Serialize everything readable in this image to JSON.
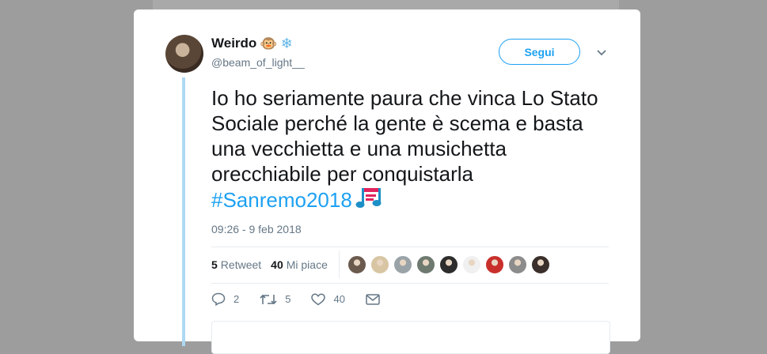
{
  "tweet": {
    "display_name": "Weirdo",
    "name_emojis": [
      "🐵",
      "❄"
    ],
    "handle": "@beam_of_light__",
    "follow_label": "Segui",
    "text": "Io ho seriamente paura che vinca Lo Stato Sociale perché la gente è scema e basta una vecchietta e una musichetta orecchiabile per conquistarla",
    "hashtag": "#Sanremo2018",
    "timestamp": "09:26 - 9 feb 2018"
  },
  "stats": {
    "retweets_count": "5",
    "retweets_label": "Retweet",
    "likes_count": "40",
    "likes_label": "Mi piace",
    "likers": [
      "#6b5a4e",
      "#d8c5a3",
      "#9aa3a8",
      "#6e7a70",
      "#2d2d2d",
      "#f0f0f0",
      "#c9302c",
      "#8c8c8c",
      "#3a2f2a"
    ]
  },
  "actions": {
    "reply_count": "2",
    "retweet_count": "5",
    "like_count": "40"
  },
  "colors": {
    "accent": "#1da1f2",
    "thread_line": "#aed8f3",
    "muted": "#657786"
  }
}
